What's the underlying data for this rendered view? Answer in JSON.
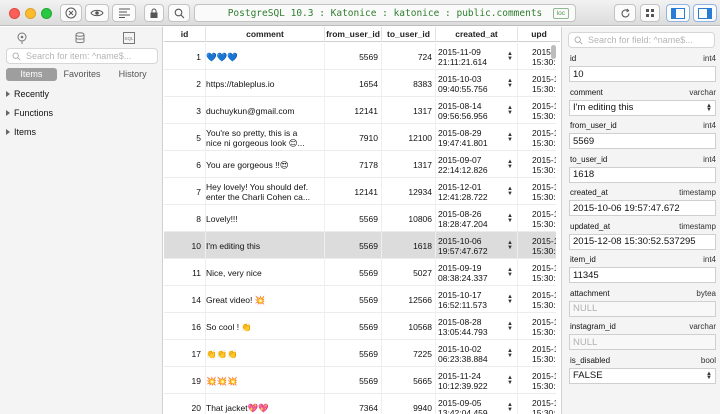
{
  "titlebar": {
    "connection": "PostgreSQL 10.3 : Katonice : katonice : public.comments",
    "badge": "loc"
  },
  "sidebar": {
    "search_placeholder": "Search for item: ^name$...",
    "tabs": [
      "Items",
      "Favorites",
      "History"
    ],
    "tree": [
      "Recently",
      "Functions",
      "Items"
    ]
  },
  "table": {
    "headers": [
      "id",
      "comment",
      "from_user_id",
      "to_user_id",
      "created_at",
      "upd"
    ],
    "rows": [
      {
        "id": "1",
        "comment": "💙💙💙",
        "from": "5569",
        "to": "724",
        "created_d": "2015-11-09",
        "created_t": "21:11:21.614",
        "upd_d": "2015-1",
        "upd_t": "15:30:5"
      },
      {
        "id": "2",
        "comment": "https://tableplus.io",
        "from": "1654",
        "to": "8383",
        "created_d": "2015-10-03",
        "created_t": "09:40:55.756",
        "upd_d": "2015-1",
        "upd_t": "15:30:5"
      },
      {
        "id": "3",
        "comment": "duchuykun@gmail.com",
        "from": "12141",
        "to": "1317",
        "created_d": "2015-08-14",
        "created_t": "09:56:56.956",
        "upd_d": "2015-1",
        "upd_t": "15:30:5"
      },
      {
        "id": "5",
        "comment": "You're so pretty, this is a",
        "comment2": "nice ni gorgeous look 😊...",
        "from": "7910",
        "to": "12100",
        "created_d": "2015-08-29",
        "created_t": "19:47:41.801",
        "upd_d": "2015-1",
        "upd_t": "15:30:5"
      },
      {
        "id": "6",
        "comment": "You are gorgeous !!😍",
        "from": "7178",
        "to": "1317",
        "created_d": "2015-09-07",
        "created_t": "22:14:12.826",
        "upd_d": "2015-1",
        "upd_t": "15:30:5"
      },
      {
        "id": "7",
        "comment": "Hey lovely! You should def.",
        "comment2": "enter the Charli Cohen ca...",
        "from": "12141",
        "to": "12934",
        "created_d": "2015-12-01",
        "created_t": "12:41:28.722",
        "upd_d": "2015-1",
        "upd_t": "15:30:5"
      },
      {
        "id": "8",
        "comment": "Lovely!!!",
        "from": "5569",
        "to": "10806",
        "created_d": "2015-08-26",
        "created_t": "18:28:47.204",
        "upd_d": "2015-1",
        "upd_t": "15:30:5"
      },
      {
        "id": "10",
        "comment": "I'm editing this",
        "from": "5569",
        "to": "1618",
        "created_d": "2015-10-06",
        "created_t": "19:57:47.672",
        "upd_d": "2015-1",
        "upd_t": "15:30:5",
        "selected": true
      },
      {
        "id": "11",
        "comment": "Nice, very nice",
        "from": "5569",
        "to": "5027",
        "created_d": "2015-09-19",
        "created_t": "08:38:24.337",
        "upd_d": "2015-1",
        "upd_t": "15:30:5"
      },
      {
        "id": "14",
        "comment": "Great video! 💥",
        "from": "5569",
        "to": "12566",
        "created_d": "2015-10-17",
        "created_t": "16:52:11.573",
        "upd_d": "2015-1",
        "upd_t": "15:30:5"
      },
      {
        "id": "16",
        "comment": "So cool ! 👏",
        "from": "5569",
        "to": "10568",
        "created_d": "2015-08-28",
        "created_t": "13:05:44.793",
        "upd_d": "2015-1",
        "upd_t": "15:30:5"
      },
      {
        "id": "17",
        "comment": "👏👏👏",
        "from": "5569",
        "to": "7225",
        "created_d": "2015-10-02",
        "created_t": "06:23:38.884",
        "upd_d": "2015-1",
        "upd_t": "15:30:5"
      },
      {
        "id": "19",
        "comment": "💥💥💥",
        "from": "5569",
        "to": "5665",
        "created_d": "2015-11-24",
        "created_t": "10:12:39.922",
        "upd_d": "2015-1",
        "upd_t": "15:30:5"
      },
      {
        "id": "20",
        "comment": "That jacket💖💖",
        "from": "7364",
        "to": "9940",
        "created_d": "2015-09-05",
        "created_t": "13:42:04.459",
        "upd_d": "2015-1",
        "upd_t": "15:30:5"
      }
    ]
  },
  "inspector": {
    "search_placeholder": "Search for field: ^name$...",
    "fields": [
      {
        "name": "id",
        "type": "int4",
        "value": "10"
      },
      {
        "name": "comment",
        "type": "varchar",
        "value": "I'm editing this"
      },
      {
        "name": "from_user_id",
        "type": "int4",
        "value": "5569"
      },
      {
        "name": "to_user_id",
        "type": "int4",
        "value": "1618"
      },
      {
        "name": "created_at",
        "type": "timestamp",
        "value": "2015-10-06 19:57:47.672"
      },
      {
        "name": "updated_at",
        "type": "timestamp",
        "value": "2015-12-08 15:30:52.537295"
      },
      {
        "name": "item_id",
        "type": "int4",
        "value": "11345"
      },
      {
        "name": "attachment",
        "type": "bytea",
        "value": "NULL",
        "null": true
      },
      {
        "name": "instagram_id",
        "type": "varchar",
        "value": "NULL",
        "null": true
      },
      {
        "name": "is_disabled",
        "type": "bool",
        "value": "FALSE"
      }
    ]
  },
  "colors": {
    "accent": "#2a7bd6",
    "connection_text": "#2f7d2f",
    "selected_row": "#dcdcdc"
  },
  "icons": [
    "close-circle-icon",
    "eye-icon",
    "format-icon",
    "lock-icon",
    "search-icon",
    "refresh-icon",
    "grid-icon",
    "left-panel-icon",
    "right-panel-icon",
    "plug-icon",
    "database-icon",
    "sql-icon"
  ]
}
